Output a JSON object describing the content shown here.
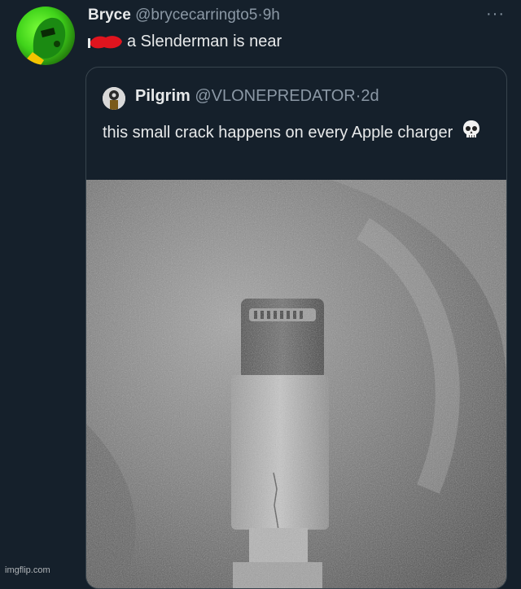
{
  "tweet": {
    "name": "Bryce",
    "handle": "@brycecarringto5",
    "separator": "·",
    "time": "9h",
    "text": "a Slenderman is near",
    "more": "···"
  },
  "quoted": {
    "name": "Pilgrim",
    "handle": "@VLONEPREDATOR",
    "separator": "·",
    "time": "2d",
    "text": "this small crack happens on every Apple charger"
  },
  "watermark": "imgflip.com",
  "colors": {
    "background": "#15202b",
    "border": "#38444d",
    "secondary_text": "#8b98a5",
    "primary_text": "#e7e9ea",
    "scribble": "#e0141e"
  },
  "icons": {
    "more": "more-horizontal-icon",
    "skull": "skull-emoji-icon"
  }
}
